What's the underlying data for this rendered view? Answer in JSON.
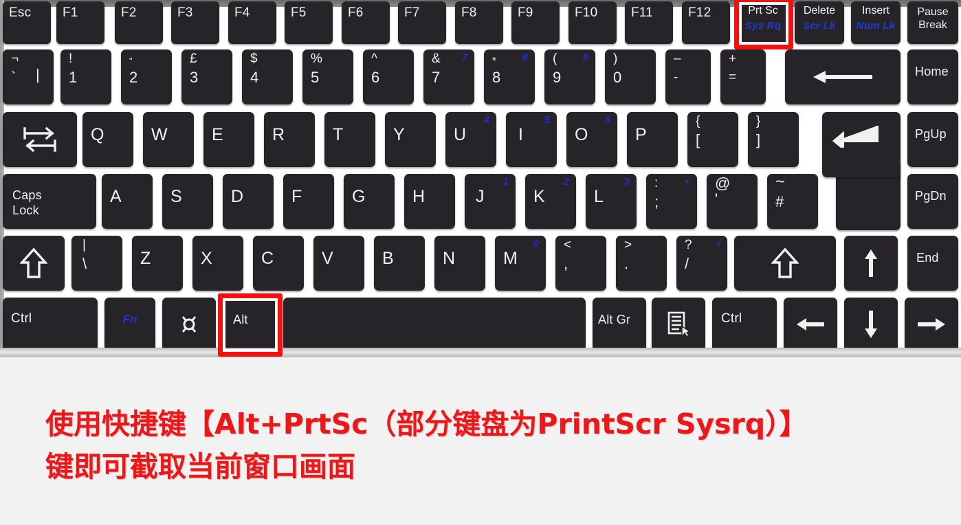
{
  "diagram": {
    "title": "laptop-keyboard-layout-uk",
    "accent_red": "#f50f0f",
    "key_color": "#272429",
    "legend_color": "#f1f1f1",
    "blue_legend_color": "#1b2ecb",
    "caption_color": "#e8181b",
    "caption_bg": "#f2f2f2"
  },
  "caption": {
    "line1": "使用快捷键【Alt+PrtSc（部分键盘为PrintScr Sysrq）】",
    "line2": "键即可截取当前窗口画面"
  },
  "highlights": [
    {
      "target": "prt-sc-key",
      "color": "#f50f0f"
    },
    {
      "target": "alt-key",
      "color": "#f50f0f"
    }
  ],
  "rows": {
    "function_row": [
      {
        "main": "Esc"
      },
      {
        "main": "F1"
      },
      {
        "main": "F2"
      },
      {
        "main": "F3"
      },
      {
        "main": "F4"
      },
      {
        "main": "F5"
      },
      {
        "main": "F6"
      },
      {
        "main": "F7"
      },
      {
        "main": "F8"
      },
      {
        "main": "F9"
      },
      {
        "main": "F10"
      },
      {
        "main": "F11"
      },
      {
        "main": "F12"
      },
      {
        "main": "Prt Sc",
        "sub": "Sys Rq",
        "highlighted": true
      },
      {
        "main": "Delete",
        "sub": "Scr Lk"
      },
      {
        "main": "Insert",
        "sub": "Num Lk"
      },
      {
        "main": "Pause\nBreak"
      }
    ],
    "number_row": [
      {
        "upper": "¬",
        "lower": "`",
        "extra": "|"
      },
      {
        "upper": "!",
        "lower": "1"
      },
      {
        "upper": "\"",
        "lower": "2"
      },
      {
        "upper": "£",
        "lower": "3"
      },
      {
        "upper": "$",
        "lower": "4"
      },
      {
        "upper": "%",
        "lower": "5"
      },
      {
        "upper": "^",
        "lower": "6"
      },
      {
        "upper": "&",
        "lower": "7",
        "blue": "7"
      },
      {
        "upper": "*",
        "lower": "8",
        "blue": "8"
      },
      {
        "upper": "(",
        "lower": "9",
        "blue": "9"
      },
      {
        "upper": ")",
        "lower": "0",
        "blue": "·"
      },
      {
        "upper": "–",
        "lower": "-"
      },
      {
        "upper": "+",
        "lower": "="
      },
      {
        "icon": "backspace-arrow-icon"
      },
      {
        "main": "Home"
      }
    ],
    "qwerty_row": [
      {
        "icon": "tab-icon"
      },
      {
        "main": "Q"
      },
      {
        "main": "W"
      },
      {
        "main": "E"
      },
      {
        "main": "R"
      },
      {
        "main": "T"
      },
      {
        "main": "Y"
      },
      {
        "main": "U",
        "blue": "4"
      },
      {
        "main": "I",
        "blue": "5"
      },
      {
        "main": "O",
        "blue": "6"
      },
      {
        "main": "P",
        "blue": "·"
      },
      {
        "upper": "{",
        "lower": "["
      },
      {
        "upper": "}",
        "lower": "]"
      },
      {
        "icon": "enter-icon"
      },
      {
        "main": "PgUp"
      }
    ],
    "home_row": [
      {
        "main": "Caps\nLock"
      },
      {
        "main": "A"
      },
      {
        "main": "S"
      },
      {
        "main": "D"
      },
      {
        "main": "F"
      },
      {
        "main": "G"
      },
      {
        "main": "H"
      },
      {
        "main": "J",
        "blue": "1"
      },
      {
        "main": "K",
        "blue": "2"
      },
      {
        "main": "L",
        "blue": "3"
      },
      {
        "upper": ":",
        "lower": ";",
        "blue": "+"
      },
      {
        "upper": "@",
        "lower": "'"
      },
      {
        "upper": "~",
        "lower": "#"
      },
      {
        "main": "PgDn"
      }
    ],
    "shift_row": [
      {
        "icon": "shift-up-arrow-icon"
      },
      {
        "upper": "|",
        "lower": "\\"
      },
      {
        "main": "Z"
      },
      {
        "main": "X"
      },
      {
        "main": "C"
      },
      {
        "main": "V"
      },
      {
        "main": "B"
      },
      {
        "main": "N"
      },
      {
        "main": "M",
        "blue": "0"
      },
      {
        "upper": "<",
        "lower": ","
      },
      {
        "upper": ">",
        "lower": "."
      },
      {
        "upper": "?",
        "lower": "/",
        "blue": "/"
      },
      {
        "icon": "shift-up-arrow-icon"
      },
      {
        "icon": "arrow-up-icon"
      },
      {
        "main": "End"
      }
    ],
    "bottom_row": [
      {
        "main": "Ctrl"
      },
      {
        "main": "Fn",
        "style": "blue-italic"
      },
      {
        "icon": "super-key-icon"
      },
      {
        "main": "Alt",
        "highlighted": true
      },
      {
        "main": "",
        "role": "spacebar"
      },
      {
        "main": "Alt Gr"
      },
      {
        "icon": "context-menu-icon"
      },
      {
        "main": "Ctrl"
      },
      {
        "icon": "arrow-left-icon"
      },
      {
        "icon": "arrow-down-icon"
      },
      {
        "icon": "arrow-right-icon"
      }
    ]
  }
}
